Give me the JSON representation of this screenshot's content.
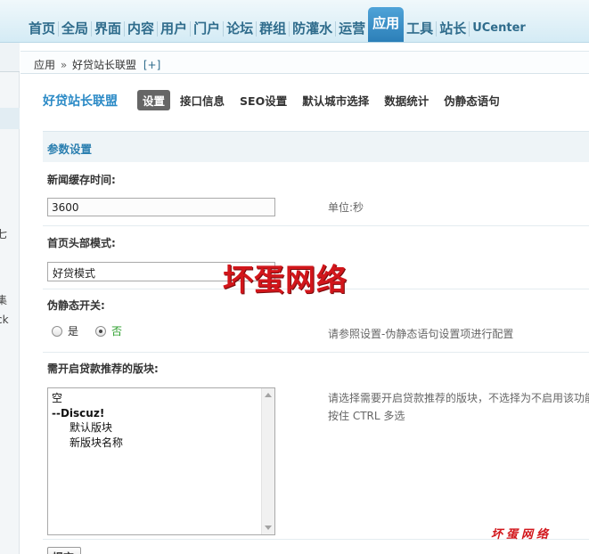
{
  "topnav": {
    "items": [
      {
        "label": "首页"
      },
      {
        "label": "全局"
      },
      {
        "label": "界面"
      },
      {
        "label": "内容"
      },
      {
        "label": "用户"
      },
      {
        "label": "门户"
      },
      {
        "label": "论坛"
      },
      {
        "label": "群组"
      },
      {
        "label": "防灌水"
      },
      {
        "label": "运营"
      },
      {
        "label": "应用"
      },
      {
        "label": "工具"
      },
      {
        "label": "站长"
      },
      {
        "label": "UCenter"
      }
    ],
    "active": "应用"
  },
  "sidebar": {
    "fragments": [
      "七",
      "集",
      "ck"
    ]
  },
  "breadcrumb": {
    "root": "应用",
    "separator": "»",
    "current": "好贷站长联盟",
    "add": "[+]"
  },
  "plugin": {
    "title": "好贷站长联盟",
    "tabs": [
      {
        "label": "设置",
        "active": true
      },
      {
        "label": "接口信息"
      },
      {
        "label": "SEO设置"
      },
      {
        "label": "默认城市选择"
      },
      {
        "label": "数据统计"
      },
      {
        "label": "伪静态语句"
      }
    ]
  },
  "settings": {
    "section_title": "参数设置",
    "cache_time": {
      "label": "新闻缓存时间:",
      "value": "3600",
      "hint": "单位:秒"
    },
    "header_mode": {
      "label": "首页头部模式:",
      "selected": "好贷模式"
    },
    "pseudo_static": {
      "label": "伪静态开关:",
      "options": [
        "是",
        "否"
      ],
      "selected": "否",
      "hint": "请参照设置-伪静态语句设置项进行配置"
    },
    "forums": {
      "label": "需开启贷款推荐的版块:",
      "options": [
        {
          "text": "空",
          "type": "plain"
        },
        {
          "text": "--Discuz!",
          "type": "group"
        },
        {
          "text": "默认版块",
          "type": "indent"
        },
        {
          "text": "新版块名称",
          "type": "indent"
        }
      ],
      "hint_line1": "请选择需要开启贷款推荐的版块，不选择为不启用该功能",
      "hint_line2": "按住 CTRL 多选"
    },
    "submit_label": "提交"
  },
  "watermark": {
    "big": "坏蛋网络",
    "small": "坏蛋网络"
  },
  "colors": {
    "nav_text": "#2f6c8c",
    "nav_active": "#2c7fb8",
    "plugin_title": "#2b8ac6",
    "watermark": "#d2161b"
  }
}
